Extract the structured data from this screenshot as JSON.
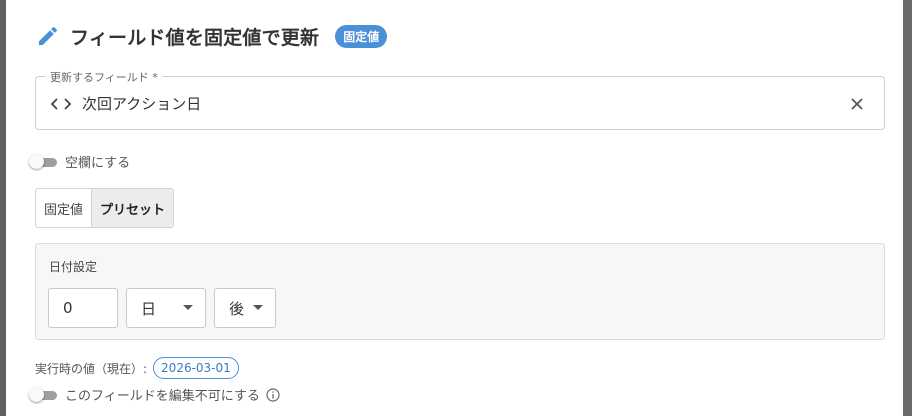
{
  "header": {
    "title": "フィールド値を固定値で更新",
    "badge": "固定値",
    "icon": "pencil-icon"
  },
  "field": {
    "label": "更新するフィールド *",
    "value": "次回アクション日",
    "icon": "code-icon",
    "clear_icon": "close-icon"
  },
  "blank_toggle": {
    "label": "空欄にする",
    "checked": false
  },
  "mode_tabs": [
    {
      "label": "固定値",
      "active": false
    },
    {
      "label": "プリセット",
      "active": true
    }
  ],
  "date_setting": {
    "label": "日付設定",
    "amount": "0",
    "unit": "日",
    "direction": "後"
  },
  "execution": {
    "label": "実行時の値（現在）:",
    "value": "2026-03-01"
  },
  "readonly_toggle": {
    "label": "このフィールドを編集不可にする",
    "checked": false,
    "icon": "info-icon"
  },
  "colors": {
    "accent": "#4a90d9",
    "text": "#333333",
    "panel_bg": "#ffffff",
    "backdrop": "#5f5f5f"
  }
}
